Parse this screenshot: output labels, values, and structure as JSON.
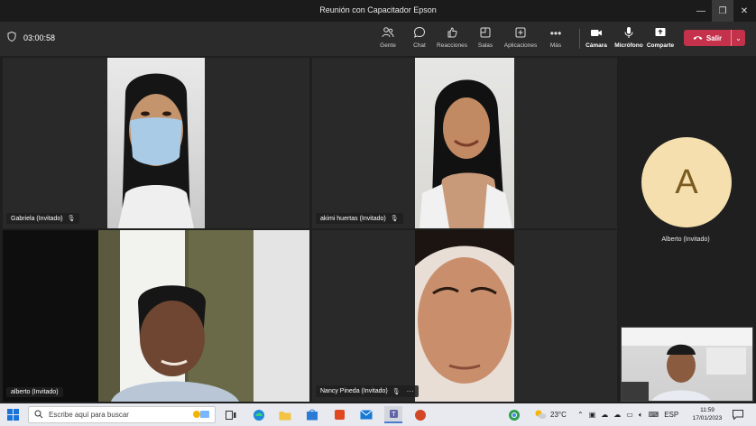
{
  "window": {
    "title": "Reunión con Capacitador Epson"
  },
  "toolbar": {
    "timer": "03:00:58",
    "items": [
      {
        "label": "Gente",
        "icon": "people-icon"
      },
      {
        "label": "Chat",
        "icon": "chat-icon"
      },
      {
        "label": "Reacciones",
        "icon": "reactions-icon"
      },
      {
        "label": "Salas",
        "icon": "rooms-icon"
      },
      {
        "label": "Aplicaciones",
        "icon": "apps-icon"
      },
      {
        "label": "Más",
        "icon": "more-icon"
      }
    ],
    "media": [
      {
        "label": "Cámara",
        "icon": "camera-icon"
      },
      {
        "label": "Micrófono",
        "icon": "microphone-icon"
      },
      {
        "label": "Comparte",
        "icon": "share-icon"
      }
    ],
    "leave_label": "Salir",
    "leave_color": "#c4314b"
  },
  "participants": {
    "gabriela": "Gabriela (Invitado)",
    "akimi": "akimi huertas (Invitado)",
    "alberto_video": "alberto (Invitado)",
    "nancy": "Nancy Pineda (Invitado)",
    "alberto_avatar_initial": "A",
    "alberto_avatar_name": "Alberto (Invitado)",
    "avatar_color": "#f5dfae"
  },
  "taskbar": {
    "search_placeholder": "Escribe aquí para buscar",
    "weather": "23°C",
    "language": "ESP",
    "time": "11:59",
    "date": "17/01/2023"
  }
}
